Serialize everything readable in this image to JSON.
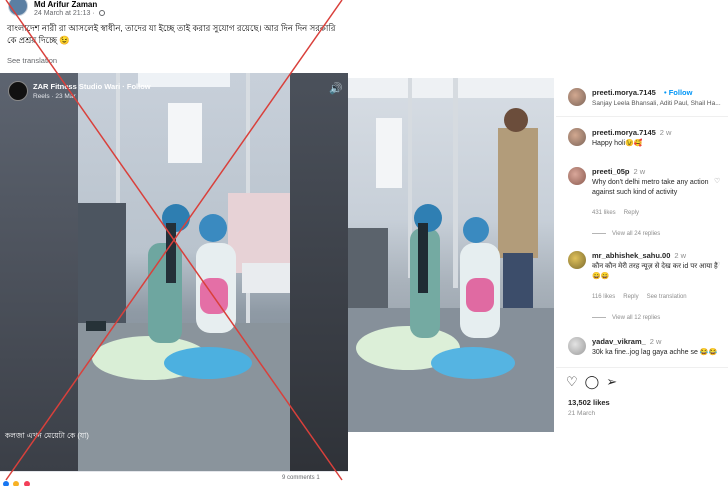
{
  "facebook": {
    "author": "Md Arifur Zaman",
    "timestamp": "24 March at 21:13",
    "post_text": "বাংলাদেশ নারী রা আসলেই স্বাধীন, তাদের যা ইচ্ছে তাই করার সুযোগ রয়েছে। আর দিন দিন সরকারি কে প্রশ্রয় দিচ্ছে 😉",
    "see_translation": "See translation",
    "reel": {
      "page_name": "ZAR Fitness Studio Wari · Follow",
      "meta": "Reels · 23 Mar",
      "caption": "কলজা এখন মেয়েটা কে (যা)",
      "speaker_icon": "speaker-icon"
    },
    "footer": {
      "stats": "9 comments  1"
    },
    "cross_color": "#d9403b"
  },
  "instagram": {
    "header": {
      "username": "preeti.morya.7145",
      "follow": "• Follow",
      "audio": "Sanjay Leela Bhansali, Aditi Paul, Shail Ha..."
    },
    "comments": [
      {
        "user": "preeti.morya.7145",
        "time": "2 w",
        "text": "Happy holi😉🥰",
        "actions": [],
        "view_replies": ""
      },
      {
        "user": "preeti_05p",
        "time": "2 w",
        "text": "Why don't delhi metro take any action against such kind of activity",
        "actions": [
          "431 likes",
          "Reply"
        ],
        "view_replies": "View all 24 replies"
      },
      {
        "user": "mr_abhishek_sahu.00",
        "time": "2 w",
        "text": "कौन कौन मेरी तरह न्यूज़ से देख कर id पर आया है 😄😄",
        "actions": [
          "116 likes",
          "Reply",
          "See translation"
        ],
        "view_replies": "View all 12 replies"
      },
      {
        "user": "yadav_vikram_",
        "time": "2 w",
        "text": "30k ka fine..jog lag gaya achhe se 😂😂",
        "actions": [],
        "view_replies": ""
      }
    ],
    "likes": "13,502 likes",
    "date": "21 March",
    "icons": [
      "heart-icon",
      "comment-icon",
      "share-icon"
    ]
  }
}
